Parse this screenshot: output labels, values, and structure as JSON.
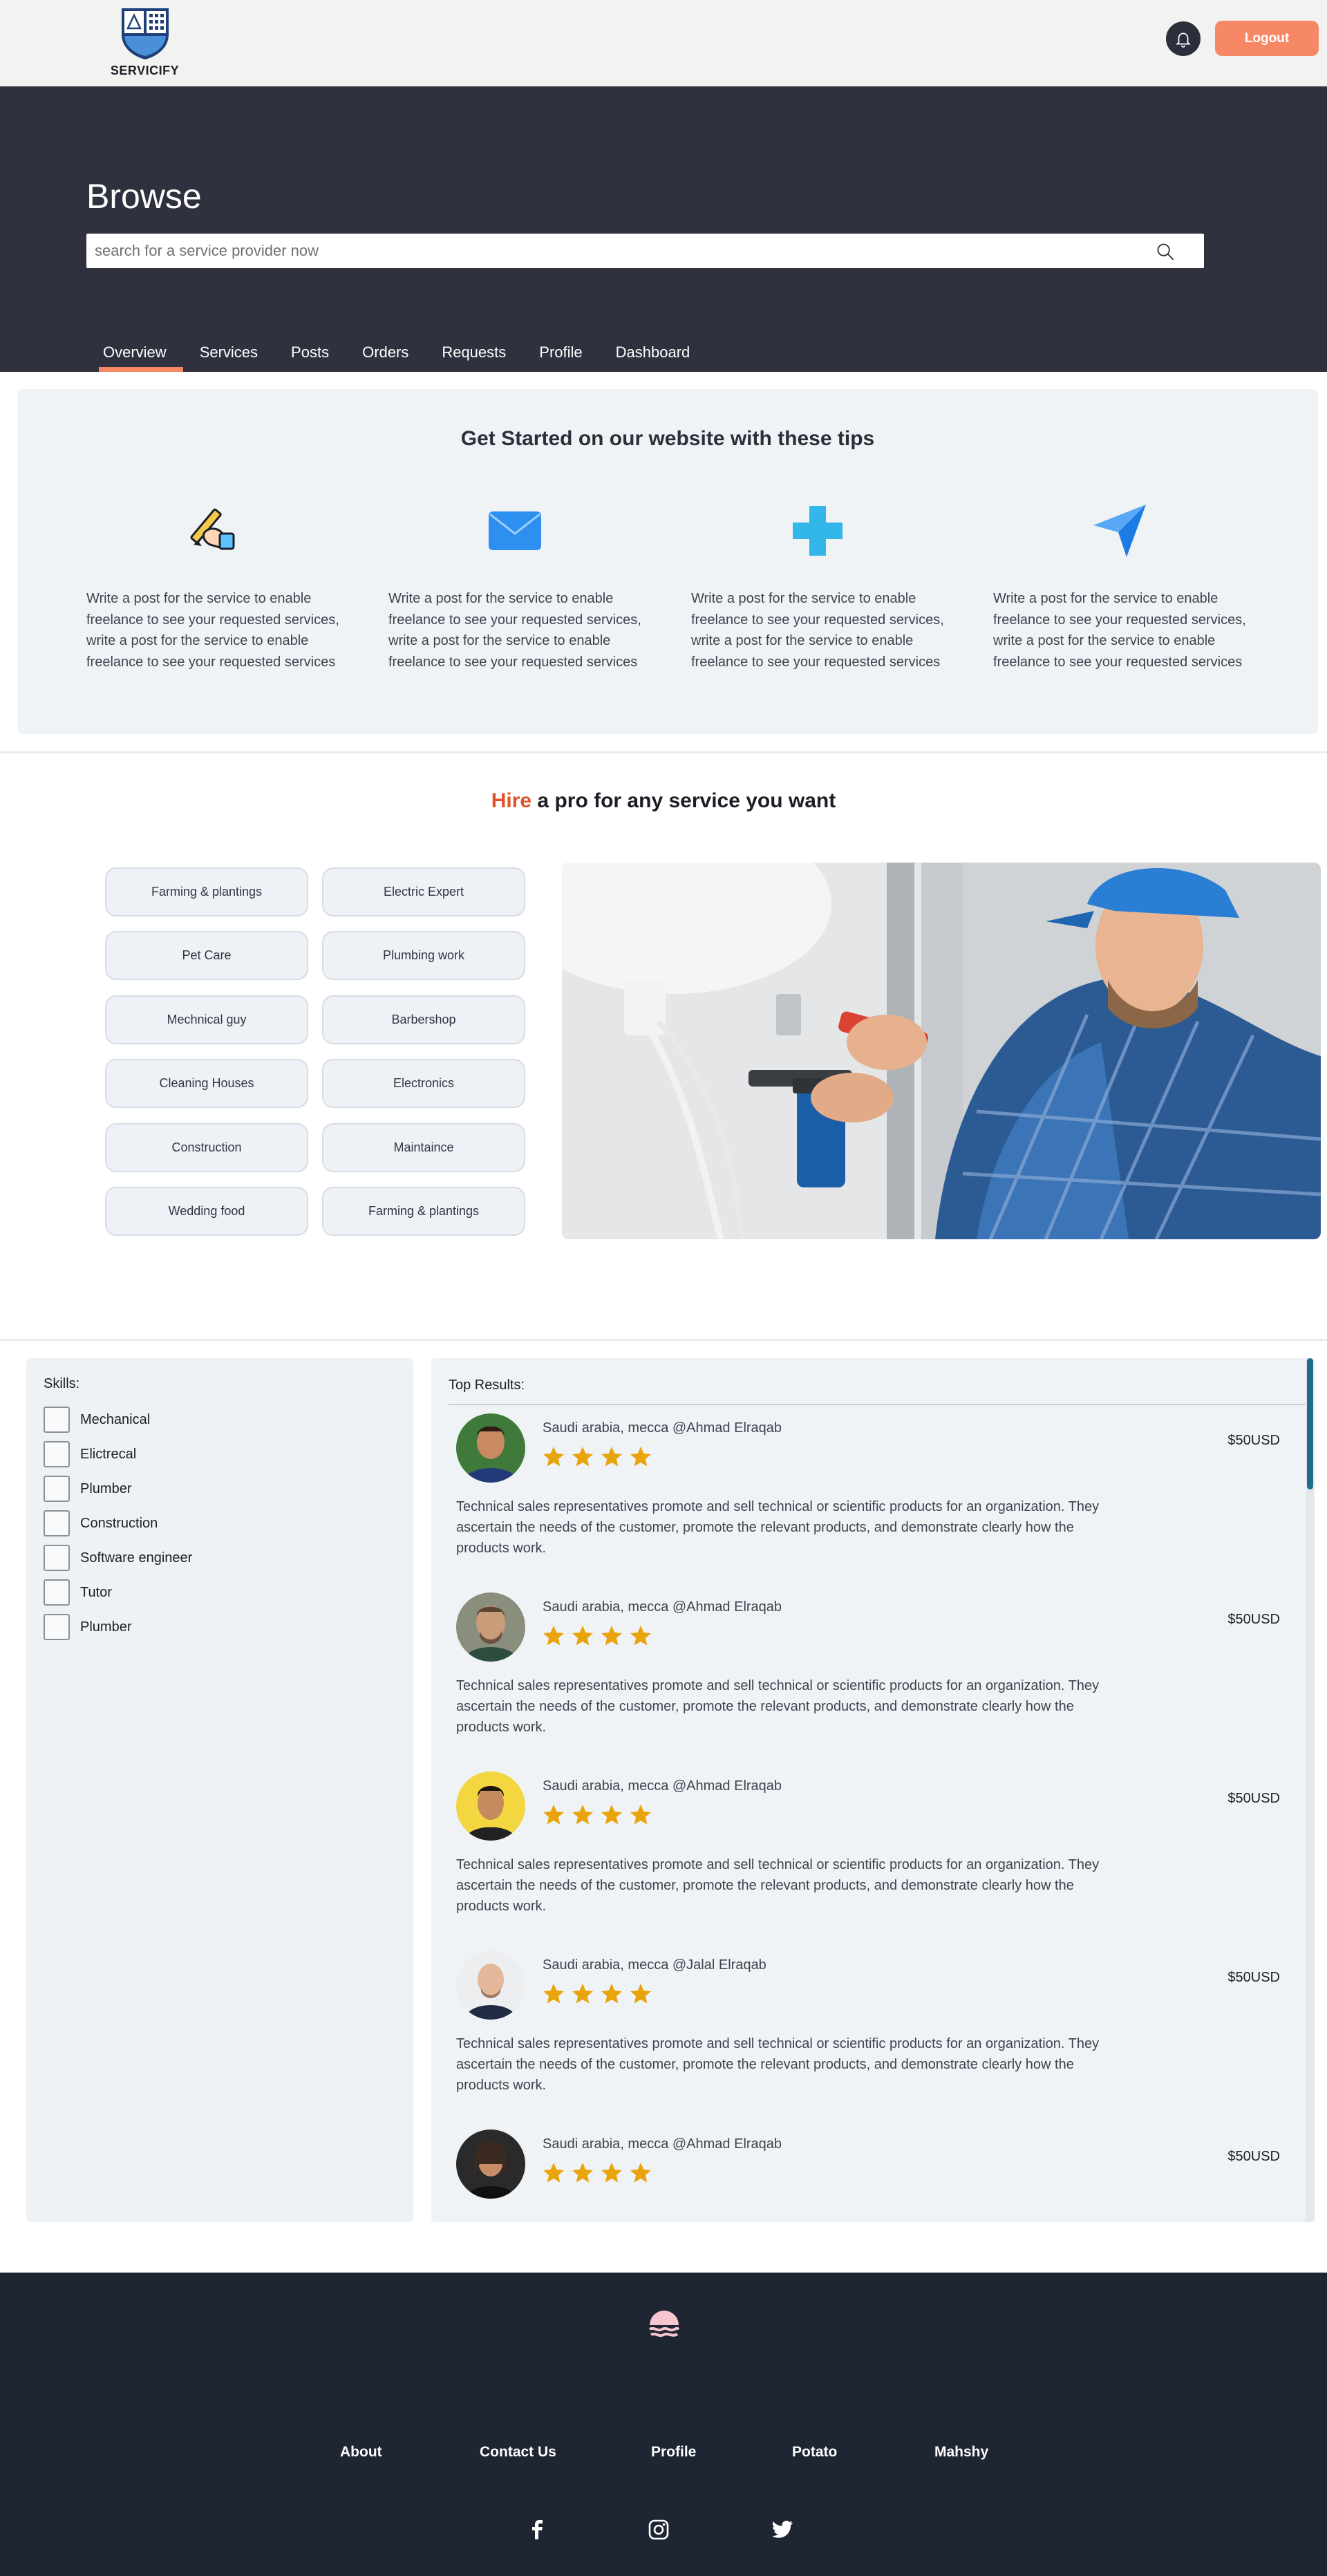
{
  "brand": {
    "name": "SERVICIFY"
  },
  "header": {
    "logout_label": "Logout"
  },
  "hero": {
    "title": "Browse",
    "search_placeholder": "search for a service provider now",
    "tabs": [
      "Overview",
      "Services",
      "Posts",
      "Orders",
      "Requests",
      "Profile",
      "Dashboard"
    ],
    "active_tab": "Overview"
  },
  "tips": {
    "title": "Get Started on our website with these tips",
    "items": [
      {
        "icon": "writing-hand-icon",
        "text": "Write a post for the service to enable freelance to see your requested services, write a post for the service to enable freelance to see your requested services"
      },
      {
        "icon": "envelope-icon",
        "text": "Write a post for the service to enable freelance to see your requested services, write a post for the service to enable freelance to see your requested services"
      },
      {
        "icon": "plus-icon",
        "text": "Write a post for the service to enable freelance to see your requested services, write a post for the service to enable freelance to see your requested services"
      },
      {
        "icon": "send-arrow-icon",
        "text": "Write a post for the service to enable freelance to see your requested services, write a post for the service to enable freelance to see your requested services"
      }
    ]
  },
  "hire": {
    "accent": "Hire",
    "rest": " a pro for any service you want",
    "categories": [
      "Farming & plantings",
      "Electric Expert",
      "Pet Care",
      "Plumbing work",
      "Mechnical guy",
      "Barbershop",
      "Cleaning Houses",
      "Electronics",
      "Construction",
      "Maintaince",
      "Wedding food",
      "Farming & plantings"
    ]
  },
  "skills": {
    "title": "Skills:",
    "items": [
      "Mechanical",
      "Elictrecal",
      "Plumber",
      "Construction",
      "Software engineer",
      "Tutor",
      "Plumber"
    ]
  },
  "results": {
    "title": "Top Results:",
    "items": [
      {
        "provider": "Saudi arabia, mecca @Ahmad Elraqab",
        "rating": 4,
        "price": "$50USD",
        "description": "Technical sales representatives promote and sell technical or scientific products for an organization. They ascertain the needs of the customer, promote the relevant products, and demonstrate clearly how the products work."
      },
      {
        "provider": "Saudi arabia, mecca @Ahmad Elraqab",
        "rating": 4,
        "price": "$50USD",
        "description": "Technical sales representatives promote and sell technical or scientific products for an organization. They ascertain the needs of the customer, promote the relevant products, and demonstrate clearly how the products work."
      },
      {
        "provider": "Saudi arabia, mecca @Ahmad Elraqab",
        "rating": 4,
        "price": "$50USD",
        "description": "Technical sales representatives promote and sell technical or scientific products for an organization. They ascertain the needs of the customer, promote the relevant products, and demonstrate clearly how the products work."
      },
      {
        "provider": "Saudi arabia, mecca @Jalal Elraqab",
        "rating": 4,
        "price": "$50USD",
        "description": "Technical sales representatives promote and sell technical or scientific products for an organization. They ascertain the needs of the customer, promote the relevant products, and demonstrate clearly how the products work."
      },
      {
        "provider": "Saudi arabia, mecca @Ahmad Elraqab",
        "rating": 4,
        "price": "$50USD",
        "description": ""
      }
    ]
  },
  "footer": {
    "links": [
      "About",
      "Contact Us",
      "Profile",
      "Potato",
      "Mahshy"
    ],
    "social": [
      "facebook-icon",
      "instagram-icon",
      "twitter-icon"
    ]
  },
  "colors": {
    "accent": "#f78865",
    "hero_bg": "#2f323e",
    "footer_bg": "#1e2533",
    "star": "#e9a40c",
    "hire_accent": "#e0542a"
  }
}
